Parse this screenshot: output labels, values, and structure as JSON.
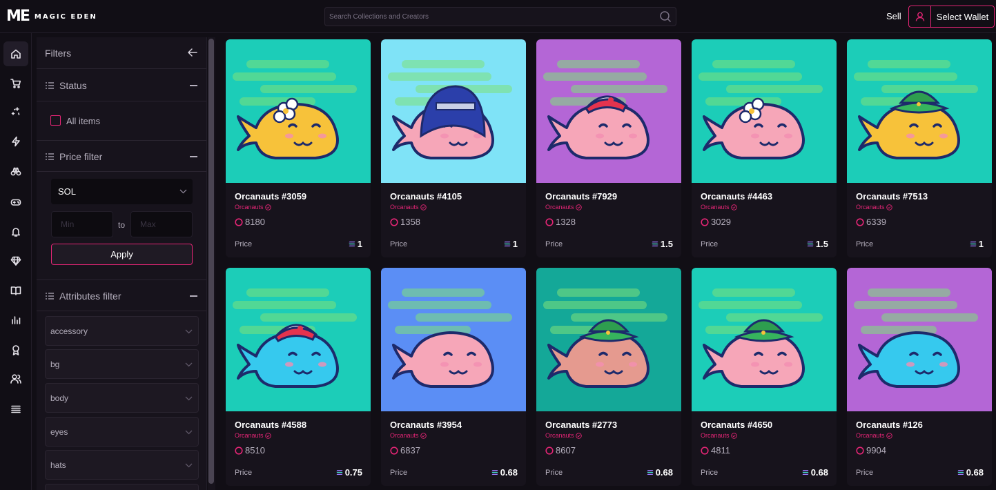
{
  "header": {
    "logo_mark": "ME",
    "logo_text": "MAGIC EDEN",
    "search_placeholder": "Search Collections and Creators",
    "sell_label": "Sell",
    "wallet_label": "Select Wallet"
  },
  "rail": {
    "icons": [
      "home-icon",
      "cart-icon",
      "sparkle-icon",
      "lightning-icon",
      "binoculars-icon",
      "gamepad-icon",
      "bell-icon",
      "diamond-icon",
      "book-icon",
      "stats-icon",
      "award-icon",
      "users-icon",
      "menu-icon"
    ]
  },
  "filters": {
    "title": "Filters",
    "status": {
      "title": "Status",
      "all_items_label": "All items"
    },
    "price": {
      "title": "Price filter",
      "currency": "SOL",
      "min_placeholder": "Min",
      "max_placeholder": "Max",
      "to_label": "to",
      "apply_label": "Apply"
    },
    "attributes": {
      "title": "Attributes filter",
      "items": [
        "accessory",
        "bg",
        "body",
        "eyes",
        "hats"
      ]
    }
  },
  "listing": {
    "price_label": "Price",
    "collection": "Orcanauts",
    "cards": [
      {
        "name": "Orcanauts #3059",
        "rank": "8180",
        "price": "1",
        "bg": "#1ccdb8",
        "body": "#f7c23a",
        "accessory": "flower"
      },
      {
        "name": "Orcanauts #4105",
        "rank": "1358",
        "price": "1",
        "bg": "#7fe3f7",
        "body": "#f6a6b8",
        "accessory": "hood"
      },
      {
        "name": "Orcanauts #7929",
        "rank": "1328",
        "price": "1.5",
        "bg": "#b466d6",
        "body": "#f6a6b8",
        "accessory": "cap"
      },
      {
        "name": "Orcanauts #4463",
        "rank": "3029",
        "price": "1.5",
        "bg": "#1ccdb8",
        "body": "#f6a6b8",
        "accessory": "flower"
      },
      {
        "name": "Orcanauts #7513",
        "rank": "6339",
        "price": "1",
        "bg": "#1ccdb8",
        "body": "#f7c23a",
        "accessory": "bucket"
      },
      {
        "name": "Orcanauts #4588",
        "rank": "8510",
        "price": "0.75",
        "bg": "#1ccdb8",
        "body": "#36c9ee",
        "accessory": "cap"
      },
      {
        "name": "Orcanauts #3954",
        "rank": "6837",
        "price": "0.68",
        "bg": "#5b8ef5",
        "body": "#f6a6b8",
        "accessory": "none"
      },
      {
        "name": "Orcanauts #2773",
        "rank": "8607",
        "price": "0.68",
        "bg": "#14a898",
        "body": "#e59a8f",
        "accessory": "bucket"
      },
      {
        "name": "Orcanauts #4650",
        "rank": "4811",
        "price": "0.68",
        "bg": "#1ccdb8",
        "body": "#f6a6b8",
        "accessory": "bucket"
      },
      {
        "name": "Orcanauts #126",
        "rank": "9904",
        "price": "0.68",
        "bg": "#b466d6",
        "body": "#36c9ee",
        "accessory": "none"
      }
    ]
  },
  "colors": {
    "accent": "#e42575",
    "background": "#110e15",
    "panel": "#17131c"
  }
}
